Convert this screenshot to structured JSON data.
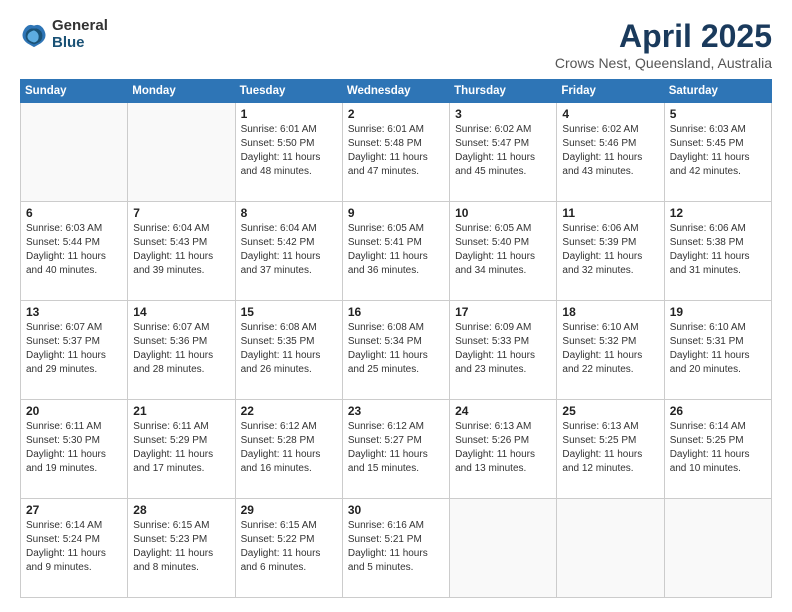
{
  "logo": {
    "general": "General",
    "blue": "Blue"
  },
  "title": "April 2025",
  "subtitle": "Crows Nest, Queensland, Australia",
  "headers": [
    "Sunday",
    "Monday",
    "Tuesday",
    "Wednesday",
    "Thursday",
    "Friday",
    "Saturday"
  ],
  "weeks": [
    [
      {
        "day": "",
        "info": ""
      },
      {
        "day": "",
        "info": ""
      },
      {
        "day": "1",
        "info": "Sunrise: 6:01 AM\nSunset: 5:50 PM\nDaylight: 11 hours and 48 minutes."
      },
      {
        "day": "2",
        "info": "Sunrise: 6:01 AM\nSunset: 5:48 PM\nDaylight: 11 hours and 47 minutes."
      },
      {
        "day": "3",
        "info": "Sunrise: 6:02 AM\nSunset: 5:47 PM\nDaylight: 11 hours and 45 minutes."
      },
      {
        "day": "4",
        "info": "Sunrise: 6:02 AM\nSunset: 5:46 PM\nDaylight: 11 hours and 43 minutes."
      },
      {
        "day": "5",
        "info": "Sunrise: 6:03 AM\nSunset: 5:45 PM\nDaylight: 11 hours and 42 minutes."
      }
    ],
    [
      {
        "day": "6",
        "info": "Sunrise: 6:03 AM\nSunset: 5:44 PM\nDaylight: 11 hours and 40 minutes."
      },
      {
        "day": "7",
        "info": "Sunrise: 6:04 AM\nSunset: 5:43 PM\nDaylight: 11 hours and 39 minutes."
      },
      {
        "day": "8",
        "info": "Sunrise: 6:04 AM\nSunset: 5:42 PM\nDaylight: 11 hours and 37 minutes."
      },
      {
        "day": "9",
        "info": "Sunrise: 6:05 AM\nSunset: 5:41 PM\nDaylight: 11 hours and 36 minutes."
      },
      {
        "day": "10",
        "info": "Sunrise: 6:05 AM\nSunset: 5:40 PM\nDaylight: 11 hours and 34 minutes."
      },
      {
        "day": "11",
        "info": "Sunrise: 6:06 AM\nSunset: 5:39 PM\nDaylight: 11 hours and 32 minutes."
      },
      {
        "day": "12",
        "info": "Sunrise: 6:06 AM\nSunset: 5:38 PM\nDaylight: 11 hours and 31 minutes."
      }
    ],
    [
      {
        "day": "13",
        "info": "Sunrise: 6:07 AM\nSunset: 5:37 PM\nDaylight: 11 hours and 29 minutes."
      },
      {
        "day": "14",
        "info": "Sunrise: 6:07 AM\nSunset: 5:36 PM\nDaylight: 11 hours and 28 minutes."
      },
      {
        "day": "15",
        "info": "Sunrise: 6:08 AM\nSunset: 5:35 PM\nDaylight: 11 hours and 26 minutes."
      },
      {
        "day": "16",
        "info": "Sunrise: 6:08 AM\nSunset: 5:34 PM\nDaylight: 11 hours and 25 minutes."
      },
      {
        "day": "17",
        "info": "Sunrise: 6:09 AM\nSunset: 5:33 PM\nDaylight: 11 hours and 23 minutes."
      },
      {
        "day": "18",
        "info": "Sunrise: 6:10 AM\nSunset: 5:32 PM\nDaylight: 11 hours and 22 minutes."
      },
      {
        "day": "19",
        "info": "Sunrise: 6:10 AM\nSunset: 5:31 PM\nDaylight: 11 hours and 20 minutes."
      }
    ],
    [
      {
        "day": "20",
        "info": "Sunrise: 6:11 AM\nSunset: 5:30 PM\nDaylight: 11 hours and 19 minutes."
      },
      {
        "day": "21",
        "info": "Sunrise: 6:11 AM\nSunset: 5:29 PM\nDaylight: 11 hours and 17 minutes."
      },
      {
        "day": "22",
        "info": "Sunrise: 6:12 AM\nSunset: 5:28 PM\nDaylight: 11 hours and 16 minutes."
      },
      {
        "day": "23",
        "info": "Sunrise: 6:12 AM\nSunset: 5:27 PM\nDaylight: 11 hours and 15 minutes."
      },
      {
        "day": "24",
        "info": "Sunrise: 6:13 AM\nSunset: 5:26 PM\nDaylight: 11 hours and 13 minutes."
      },
      {
        "day": "25",
        "info": "Sunrise: 6:13 AM\nSunset: 5:25 PM\nDaylight: 11 hours and 12 minutes."
      },
      {
        "day": "26",
        "info": "Sunrise: 6:14 AM\nSunset: 5:25 PM\nDaylight: 11 hours and 10 minutes."
      }
    ],
    [
      {
        "day": "27",
        "info": "Sunrise: 6:14 AM\nSunset: 5:24 PM\nDaylight: 11 hours and 9 minutes."
      },
      {
        "day": "28",
        "info": "Sunrise: 6:15 AM\nSunset: 5:23 PM\nDaylight: 11 hours and 8 minutes."
      },
      {
        "day": "29",
        "info": "Sunrise: 6:15 AM\nSunset: 5:22 PM\nDaylight: 11 hours and 6 minutes."
      },
      {
        "day": "30",
        "info": "Sunrise: 6:16 AM\nSunset: 5:21 PM\nDaylight: 11 hours and 5 minutes."
      },
      {
        "day": "",
        "info": ""
      },
      {
        "day": "",
        "info": ""
      },
      {
        "day": "",
        "info": ""
      }
    ]
  ]
}
